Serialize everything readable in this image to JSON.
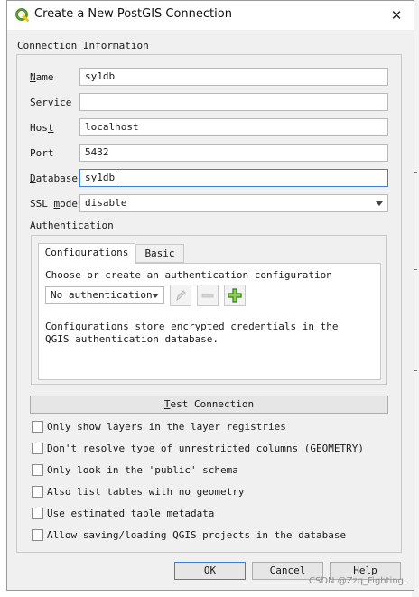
{
  "window": {
    "title": "Create a New PostGIS Connection",
    "close_glyph": "✕",
    "app_icon": "qgis-logo-icon"
  },
  "connection_info": {
    "section_title": "Connection Information",
    "fields": [
      {
        "label": "Name",
        "value": "sy1db"
      },
      {
        "label": "Service",
        "value": ""
      },
      {
        "label": "Host",
        "value": "localhost"
      },
      {
        "label": "Port",
        "value": "5432"
      },
      {
        "label": "Database",
        "value": "sy1db"
      }
    ],
    "ssl_mode": {
      "label": "SSL mode",
      "value": "disable"
    }
  },
  "authentication": {
    "title": "Authentication",
    "tabs": [
      "Configurations",
      "Basic"
    ],
    "active_tab": "Configurations",
    "prompt": "Choose or create an authentication configuration",
    "config_select": "No authentication",
    "description": "Configurations store encrypted credentials in the QGIS authentication database.",
    "buttons": {
      "edit": "pencil-icon",
      "remove": "minus-icon",
      "add": "plus-icon"
    }
  },
  "test_connection": "Test Connection",
  "options": [
    {
      "label": "Only show layers in the layer registries",
      "checked": false
    },
    {
      "label": "Don't resolve type of unrestricted columns (GEOMETRY)",
      "checked": false
    },
    {
      "label": "Only look in the 'public' schema",
      "checked": false
    },
    {
      "label": "Also list tables with no geometry",
      "checked": false
    },
    {
      "label": "Use estimated table metadata",
      "checked": false
    },
    {
      "label": "Allow saving/loading QGIS projects in the database",
      "checked": false
    }
  ],
  "buttons": {
    "ok": "OK",
    "cancel": "Cancel",
    "help": "Help"
  },
  "watermark": "CSDN @Zzq_Fighting.",
  "colors": {
    "focus_border": "#3c7fd4",
    "dialog_bg": "#f0f0f0",
    "qgis_green": "#589632",
    "qgis_yellow": "#eec90d"
  }
}
